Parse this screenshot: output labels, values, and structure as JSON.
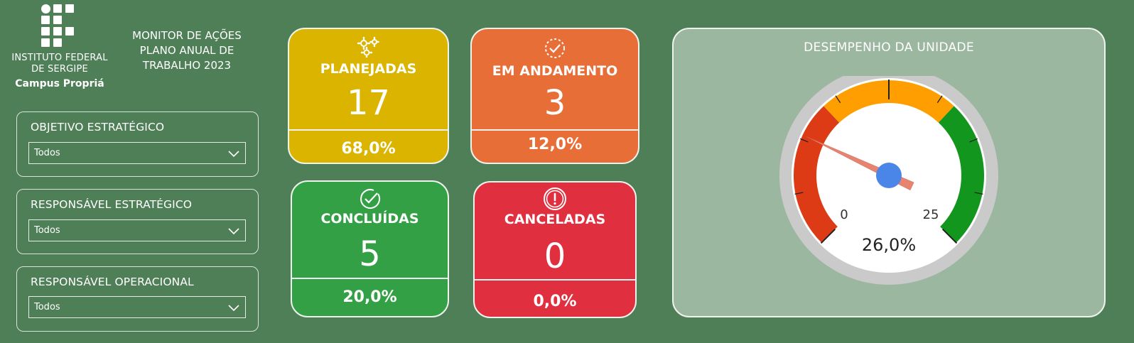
{
  "logo": {
    "line1": "INSTITUTO FEDERAL",
    "line2": "DE SERGIPE",
    "campus": "Campus Propriá"
  },
  "header": {
    "line1": "MONITOR DE AÇÕES",
    "line2": "PLANO ANUAL DE",
    "line3": "TRABALHO 2023"
  },
  "filters": [
    {
      "label": "OBJETIVO ESTRATÉGICO",
      "value": "Todos"
    },
    {
      "label": "RESPONSÁVEL ESTRATÉGICO",
      "value": "Todos"
    },
    {
      "label": "RESPONSÁVEL OPERACIONAL",
      "value": "Todos"
    }
  ],
  "cards": {
    "planejadas": {
      "title": "PLANEJADAS",
      "count": "17",
      "percent": "68,0%",
      "icon": "gears-icon",
      "color": "#dbb400"
    },
    "em_andamento": {
      "title": "EM ANDAMENTO",
      "count": "3",
      "percent": "12,0%",
      "icon": "progress-check-icon",
      "color": "#e86e38"
    },
    "concluidas": {
      "title": "CONCLUÍDAS",
      "count": "5",
      "percent": "20,0%",
      "icon": "done-check-icon",
      "color": "#33a046"
    },
    "canceladas": {
      "title": "CANCELADAS",
      "count": "0",
      "percent": "0,0%",
      "icon": "alert-icon",
      "color": "#e03040"
    }
  },
  "gauge": {
    "title": "DESEMPENHO DA UNIDADE",
    "min_label": "0",
    "max_label": "25",
    "value_label": "26,0%",
    "value_fraction": 0.26,
    "colors": {
      "low": "#dd3b16",
      "mid": "#ff9e00",
      "high": "#12961e",
      "needle": "#e8836f",
      "hub": "#4a86e8"
    }
  }
}
